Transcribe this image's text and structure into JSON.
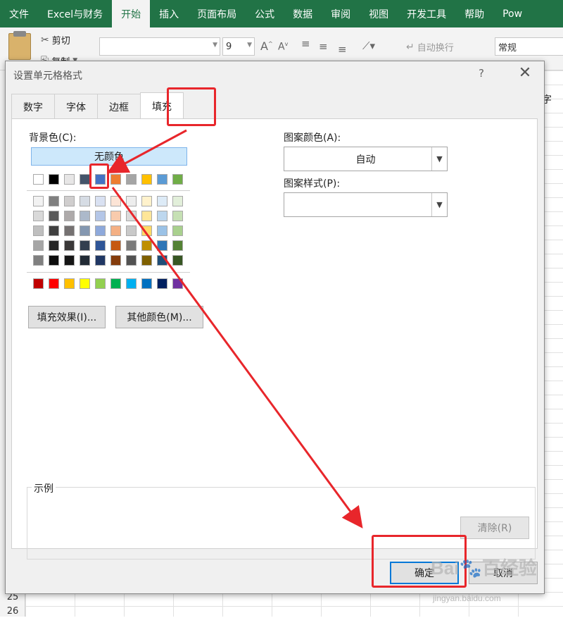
{
  "ribbon_tabs": [
    {
      "label": "文件",
      "active": false
    },
    {
      "label": "Excel与财务",
      "active": false
    },
    {
      "label": "开始",
      "active": true
    },
    {
      "label": "插入",
      "active": false
    },
    {
      "label": "页面布局",
      "active": false
    },
    {
      "label": "公式",
      "active": false
    },
    {
      "label": "数据",
      "active": false
    },
    {
      "label": "审阅",
      "active": false
    },
    {
      "label": "视图",
      "active": false
    },
    {
      "label": "开发工具",
      "active": false
    },
    {
      "label": "帮助",
      "active": false
    },
    {
      "label": "Pow",
      "active": false
    }
  ],
  "ribbon": {
    "cut_label": "剪切",
    "copy_label": "复制",
    "font_size": "9",
    "grow_font": "A",
    "shrink_font": "A",
    "wrap_text_label": "自动换行",
    "number_format": "常规"
  },
  "sheet": {
    "row_numbers": [
      "25",
      "26"
    ],
    "partial_text": "字"
  },
  "dialog": {
    "title": "设置单元格格式",
    "help": "?",
    "close": "✕",
    "tabs": [
      {
        "label": "数字",
        "active": false
      },
      {
        "label": "字体",
        "active": false
      },
      {
        "label": "边框",
        "active": false
      },
      {
        "label": "填充",
        "active": true
      }
    ],
    "background_color_label": "背景色(C):",
    "no_color_button": "无颜色",
    "pattern_color_label": "图案颜色(A):",
    "pattern_color_value": "自动",
    "pattern_style_label": "图案样式(P):",
    "pattern_style_value": "",
    "fill_effects_button": "填充效果(I)...",
    "more_colors_button": "其他颜色(M)...",
    "sample_label": "示例",
    "clear_button": "清除(R)",
    "ok_button": "确定",
    "cancel_button": "取消"
  },
  "palette": {
    "theme_row": [
      "#ffffff",
      "#000000",
      "#e7e6e6",
      "#44546a",
      "#4472c4",
      "#ed7d31",
      "#a5a5a5",
      "#ffc000",
      "#5b9bd5",
      "#70ad47"
    ],
    "tint_rows": [
      [
        "#f2f2f2",
        "#7f7f7f",
        "#d0cece",
        "#d6dce4",
        "#d9e1f2",
        "#fce4d6",
        "#ededed",
        "#fff2cc",
        "#ddebf7",
        "#e2efda"
      ],
      [
        "#d9d9d9",
        "#595959",
        "#aeaaaa",
        "#acb9ca",
        "#b4c6e7",
        "#f8cbad",
        "#dbdbdb",
        "#ffe699",
        "#bdd7ee",
        "#c6e0b4"
      ],
      [
        "#bfbfbf",
        "#404040",
        "#757171",
        "#8497b0",
        "#8ea9db",
        "#f4b084",
        "#c9c9c9",
        "#ffd966",
        "#9bc2e6",
        "#a9d08e"
      ],
      [
        "#a6a6a6",
        "#262626",
        "#3a3838",
        "#333f4f",
        "#2f5597",
        "#c65911",
        "#7b7b7b",
        "#bf8f00",
        "#2e75b6",
        "#548235"
      ],
      [
        "#808080",
        "#0d0d0d",
        "#161616",
        "#222b35",
        "#203764",
        "#843c0c",
        "#525252",
        "#7f6000",
        "#1f4e78",
        "#375623"
      ]
    ],
    "standard_row": [
      "#c00000",
      "#ff0000",
      "#ffc000",
      "#ffff00",
      "#92d050",
      "#00b050",
      "#00b0f0",
      "#0070c0",
      "#002060",
      "#7030a0"
    ]
  },
  "colors": {
    "ribbon_green": "#217346",
    "annotation_red": "#e8262b",
    "selected_swatch": "#4472c4"
  },
  "watermark": {
    "logo": "Bai🐾百经验",
    "url": "jingyan.baidu.com"
  }
}
